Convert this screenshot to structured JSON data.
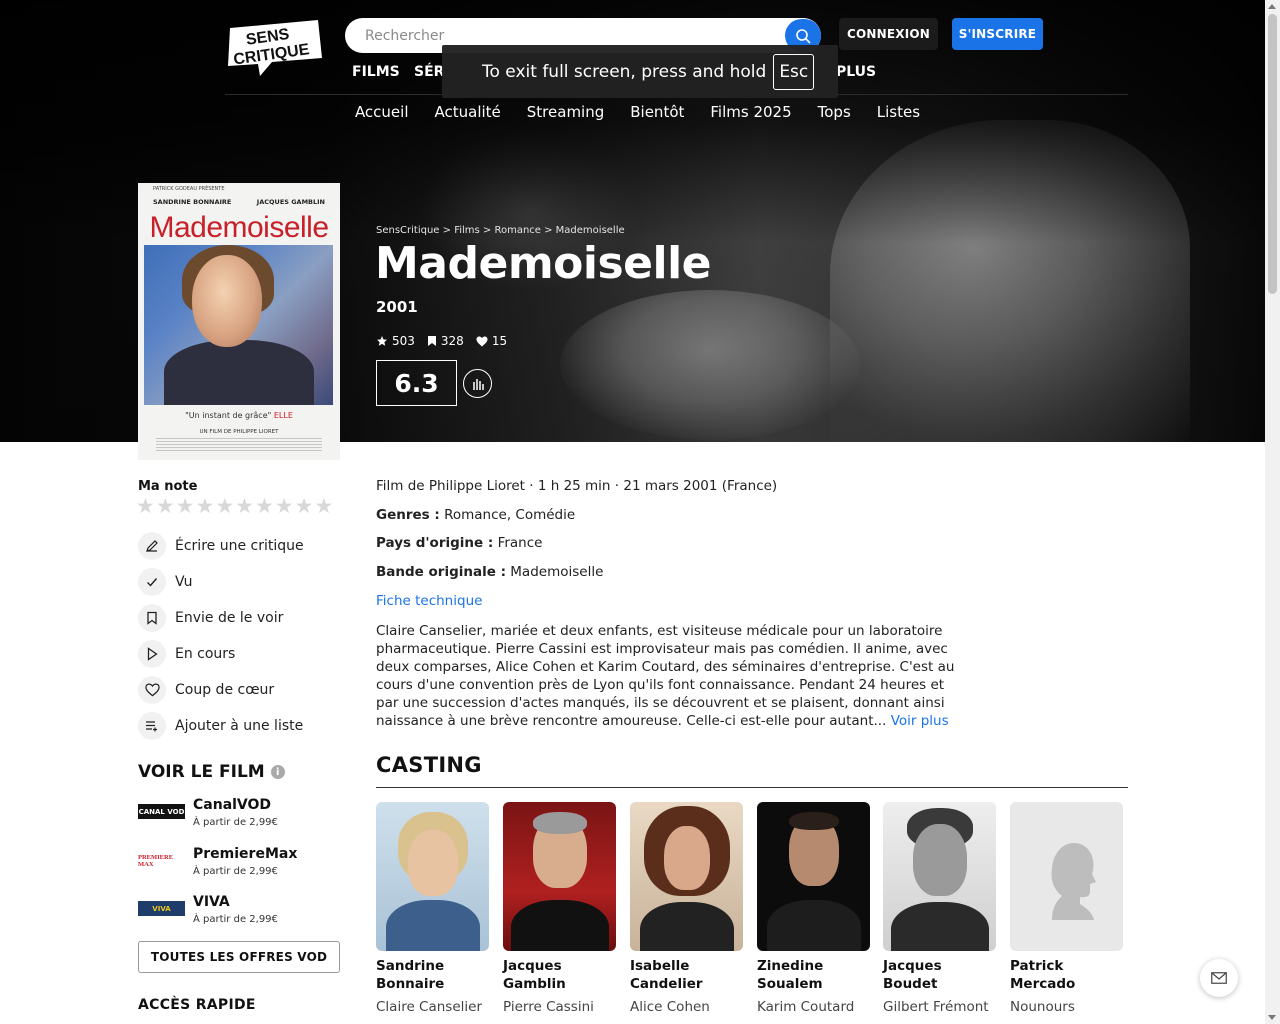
{
  "header": {
    "logo_text_top": "SENS",
    "logo_text_bottom": "CRITIQUE",
    "search_placeholder": "Rechercher",
    "login_label": "CONNEXION",
    "signup_label": "S'INSCRIRE",
    "main_nav": [
      "FILMS",
      "SÉR",
      "PLUS"
    ],
    "sub_nav": [
      "Accueil",
      "Actualité",
      "Streaming",
      "Bientôt",
      "Films 2025",
      "Tops",
      "Listes"
    ]
  },
  "fullscreen_toast": {
    "text": "To exit full screen, press and hold",
    "key": "Esc"
  },
  "poster": {
    "producer": "PATRICK GODEAU PRÉSENTE",
    "actor_left": "SANDRINE BONNAIRE",
    "actor_right": "JACQUES GAMBLIN",
    "title": "Mademoiselle",
    "quote": "\"Un instant de grâce\"",
    "quote_source": "ELLE",
    "director": "UN FILM DE PHILIPPE LIORET"
  },
  "film": {
    "breadcrumb": "SensCritique > Films > Romance > Mademoiselle",
    "title": "Mademoiselle",
    "year": "2001",
    "ratings_count": "503",
    "wishlist_count": "328",
    "favorites_count": "15",
    "rating": "6.3",
    "info_line": "Film de Philippe Lioret · 1 h 25 min · 21 mars 2001 (France)",
    "genres_label": "Genres :",
    "genres": "Romance, Comédie",
    "country_label": "Pays d'origine :",
    "country": "France",
    "soundtrack_label": "Bande originale :",
    "soundtrack": "Mademoiselle",
    "fiche_link": "Fiche technique",
    "synopsis": "Claire Canselier, mariée et deux enfants, est visiteuse médicale pour un laboratoire pharmaceutique. Pierre Cassini est improvisateur mais pas comédien. Il anime, avec deux comparses, Alice Cohen et Karim Coutard, des séminaires d'entreprise. C'est au cours d'une convention près de Lyon qu'ils font connaissance. Pendant 24 heures et par une succession d'actes manqués, ils se découvrent et se plaisent, donnant ainsi naissance à une brève rencontre amoureuse. Celle-ci est-elle pour autant...",
    "voir_plus": "Voir plus"
  },
  "sidebar": {
    "ma_note_label": "Ma note",
    "stars": [
      "★",
      "★",
      "★",
      "★",
      "★",
      "★",
      "★",
      "★",
      "★",
      "★"
    ],
    "actions": [
      {
        "label": "Écrire une critique",
        "icon": "pencil-icon"
      },
      {
        "label": "Vu",
        "icon": "check-icon"
      },
      {
        "label": "Envie de le voir",
        "icon": "bookmark-icon"
      },
      {
        "label": "En cours",
        "icon": "play-icon"
      },
      {
        "label": "Coup de cœur",
        "icon": "heart-icon"
      },
      {
        "label": "Ajouter à une liste",
        "icon": "list-add-icon"
      }
    ],
    "voir_title": "VOIR LE FILM",
    "info_symbol": "i",
    "offers": [
      {
        "name": "CanalVOD",
        "price": "À partir de 2,99€",
        "logo_text": "CANAL VOD"
      },
      {
        "name": "PremiereMax",
        "price": "À partir de 2,99€",
        "logo_text": "PREMIERE MAX"
      },
      {
        "name": "VIVA",
        "price": "À partir de 2,99€",
        "logo_text": "VIVA"
      }
    ],
    "all_offers_label": "TOUTES LES OFFRES VOD",
    "acces_rapide": "ACCÈS RAPIDE"
  },
  "casting": {
    "title": "CASTING",
    "members": [
      {
        "name": "Sandrine Bonnaire",
        "role": "Claire Canselier"
      },
      {
        "name": "Jacques Gamblin",
        "role": "Pierre Cassini"
      },
      {
        "name": "Isabelle Candelier",
        "role": "Alice Cohen"
      },
      {
        "name": "Zinedine Soualem",
        "role": "Karim Coutard"
      },
      {
        "name": "Jacques Boudet",
        "role": "Gilbert Frémont"
      },
      {
        "name": "Patrick Mercado",
        "role": "Nounours"
      }
    ]
  },
  "colors": {
    "accent": "#1a74e8",
    "poster_title": "#c8202a"
  }
}
